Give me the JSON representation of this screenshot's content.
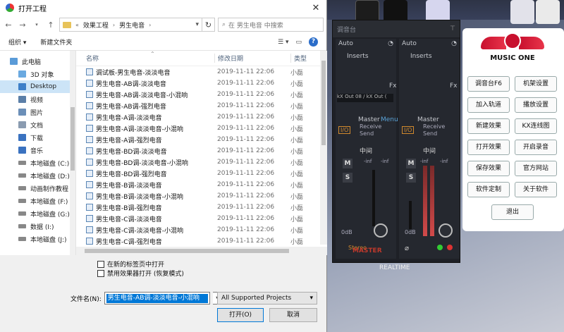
{
  "dialog": {
    "title": "打开工程",
    "close_glyph": "✕",
    "address": {
      "prefix": "«",
      "crumbs": [
        "效果工程",
        "男生电音"
      ],
      "separator": "›"
    },
    "search_placeholder": "在 男生电音 中搜索",
    "toolbar": {
      "organize": "组织 ▾",
      "new_folder": "新建文件夹",
      "help": "?"
    },
    "sidebar": [
      {
        "label": "此电脑",
        "icon": "computer-icon"
      },
      {
        "label": "3D 对象",
        "icon": "cube-icon"
      },
      {
        "label": "Desktop",
        "icon": "desktop-icon",
        "selected": true
      },
      {
        "label": "视频",
        "icon": "video-icon"
      },
      {
        "label": "图片",
        "icon": "picture-icon"
      },
      {
        "label": "文档",
        "icon": "document-icon"
      },
      {
        "label": "下载",
        "icon": "download-icon"
      },
      {
        "label": "音乐",
        "icon": "music-icon"
      },
      {
        "label": "本地磁盘 (C:)",
        "icon": "drive-icon"
      },
      {
        "label": "本地磁盘 (D:)",
        "icon": "drive-icon"
      },
      {
        "label": "动画制作教程",
        "icon": "drive-icon"
      },
      {
        "label": "本地磁盘 (F:)",
        "icon": "drive-icon"
      },
      {
        "label": "本地磁盘 (G:)",
        "icon": "drive-icon"
      },
      {
        "label": "数据 (I:)",
        "icon": "drive-icon"
      },
      {
        "label": "本地磁盘 (J:)",
        "icon": "drive-icon"
      }
    ],
    "columns": {
      "name": "名称",
      "date": "修改日期",
      "type": "类型"
    },
    "files": [
      {
        "name": "调试板-男生电音-淡淡电音",
        "date": "2019-11-11 22:06",
        "type": "小磊"
      },
      {
        "name": "男生电音-AB调-淡淡电音",
        "date": "2019-11-11 22:06",
        "type": "小磊"
      },
      {
        "name": "男生电音-AB调-淡淡电音-小混响",
        "date": "2019-11-11 22:06",
        "type": "小磊"
      },
      {
        "name": "男生电音-AB调-强烈电音",
        "date": "2019-11-11 22:06",
        "type": "小磊"
      },
      {
        "name": "男生电音-A调-淡淡电音",
        "date": "2019-11-11 22:06",
        "type": "小磊"
      },
      {
        "name": "男生电音-A调-淡淡电音-小混响",
        "date": "2019-11-11 22:06",
        "type": "小磊"
      },
      {
        "name": "男生电音-A调-强烈电音",
        "date": "2019-11-11 22:06",
        "type": "小磊"
      },
      {
        "name": "男生电音-BD调-淡淡电音",
        "date": "2019-11-11 22:06",
        "type": "小磊"
      },
      {
        "name": "男生电音-BD调-淡淡电音-小混响",
        "date": "2019-11-11 22:06",
        "type": "小磊"
      },
      {
        "name": "男生电音-BD调-强烈电音",
        "date": "2019-11-11 22:06",
        "type": "小磊"
      },
      {
        "name": "男生电音-B调-淡淡电音",
        "date": "2019-11-11 22:06",
        "type": "小磊"
      },
      {
        "name": "男生电音-B调-淡淡电音-小混响",
        "date": "2019-11-11 22:06",
        "type": "小磊"
      },
      {
        "name": "男生电音-B调-强烈电音",
        "date": "2019-11-11 22:06",
        "type": "小磊"
      },
      {
        "name": "男生电音-C调-淡淡电音",
        "date": "2019-11-11 22:06",
        "type": "小磊"
      },
      {
        "name": "男生电音-C调-淡淡电音-小混响",
        "date": "2019-11-11 22:06",
        "type": "小磊"
      },
      {
        "name": "男生电音-C调-强烈电音",
        "date": "2019-11-11 22:06",
        "type": "小磊"
      }
    ],
    "options": {
      "open_in_new_tab": "在新的标签页中打开",
      "disable_effects": "禁用效果器打开 (恢复模式)"
    },
    "filename_label": "文件名(N):",
    "filename_value": "男生电音-AB调-淡淡电音-小混响",
    "filter_value": "All Supported Projects",
    "open_button": "打开(O)",
    "cancel_button": "取消"
  },
  "mixer": {
    "title": "调音台",
    "left": {
      "auto": "Auto",
      "inserts": "Inserts",
      "fx": "Fx",
      "output": "kX Out 08 / kX Out (",
      "master": "Master",
      "menu": "Menu",
      "receive": "Receive",
      "send": "Send",
      "io": "I/O",
      "channel": "中间",
      "mute": "M",
      "solo": "S",
      "inf1": "-inf",
      "inf2": "-inf",
      "db": "0dB",
      "stereo": "Stereo",
      "bottom": "MASTER"
    },
    "right": {
      "auto": "Auto",
      "inserts": "Inserts",
      "fx": "Fx",
      "master": "Master",
      "receive": "Receive",
      "send": "Send",
      "io": "I/O",
      "channel": "中间",
      "mute": "M",
      "solo": "S",
      "inf1": "-inf",
      "inf2": "-inf",
      "db": "0dB"
    }
  },
  "music_one": {
    "brand": "MUSIC ONE",
    "buttons": [
      "调音台F6",
      "机架设置",
      "加入轨道",
      "播放设置",
      "新建效果",
      "KX连线图",
      "打开效果",
      "开启录音",
      "保存效果",
      "官方网站",
      "软件定制",
      "关于软件"
    ],
    "exit": "退出"
  },
  "desktop": {
    "realtime": "REALTIME"
  },
  "colors": {
    "accent": "#0078d7",
    "brand_red": "#c8102e",
    "mixer_bg": "#1e2026"
  }
}
